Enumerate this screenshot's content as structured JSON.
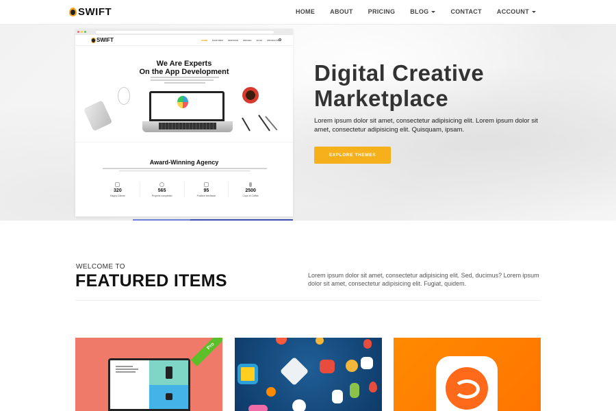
{
  "brand": {
    "name": "SWIFT"
  },
  "nav": {
    "items": [
      {
        "label": "HOME",
        "dropdown": false
      },
      {
        "label": "ABOUT",
        "dropdown": false
      },
      {
        "label": "PRICING",
        "dropdown": false
      },
      {
        "label": "BLOG",
        "dropdown": true
      },
      {
        "label": "CONTACT",
        "dropdown": false
      },
      {
        "label": "ACCOUNT",
        "dropdown": true
      }
    ]
  },
  "hero": {
    "title_line1": "Digital Creative",
    "title_line2": "Marketplace",
    "text": "Lorem ipsum dolor sit amet, consectetur adipisicing elit. Lorem ipsum dolor sit amet, consectetur adipisicing elit. Quisquam, ipsam.",
    "button": "EXPLORE THEMES",
    "mockup": {
      "logo": "SWIFT",
      "menu": [
        "HOME",
        "FEATURES",
        "SERVICES",
        "PRICING",
        "BLOG",
        "PRODUCTS"
      ],
      "heading_line1": "We Are Experts",
      "heading_line2": "On the App Development",
      "section2_heading": "Award-Winning Agency",
      "stats": [
        {
          "value": "320",
          "label": "Happy Clients"
        },
        {
          "value": "565",
          "label": "Projects completed"
        },
        {
          "value": "95",
          "label": "Positive feedback"
        },
        {
          "value": "2500",
          "label": "Cups of Coffee"
        }
      ]
    }
  },
  "featured": {
    "eyebrow": "WELCOME TO",
    "title": "FEATURED ITEMS",
    "text": "Lorem ipsum dolor sit amet, consectetur adipisicing elit. Sed, ducimus? Lorem ipsum dolor sit amet, consectetur adipisicing elit. Fugiat, quidem.",
    "cards": [
      {
        "badge": "Pro",
        "thumb": "laptop-mockup"
      },
      {
        "thumb": "icon-collection"
      },
      {
        "thumb": "app-icon"
      }
    ]
  },
  "colors": {
    "accent": "#f5b01b",
    "ribbon": "#5cbf2a",
    "card1": "#f07a6a",
    "card2": "#1f5e96",
    "card3": "#ff7f00"
  }
}
